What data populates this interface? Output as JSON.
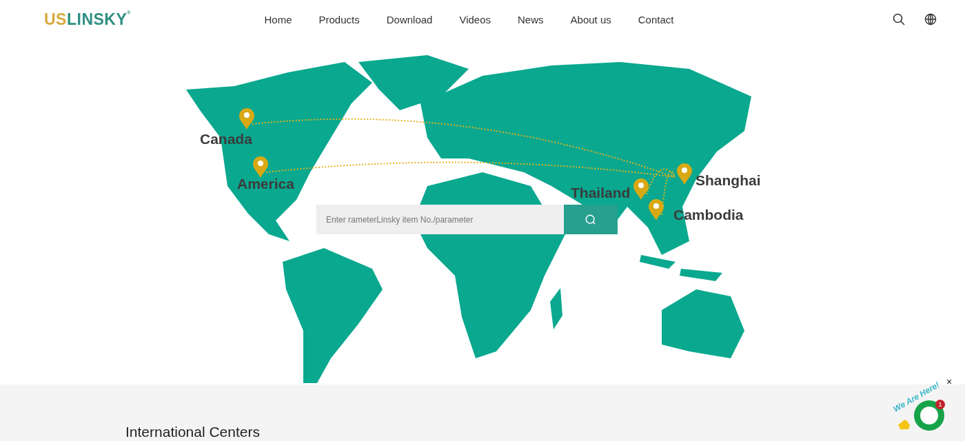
{
  "header": {
    "logo": {
      "first": "US",
      "rest": "LINSKY",
      "mark": "®"
    },
    "nav": [
      {
        "label": "Home"
      },
      {
        "label": "Products"
      },
      {
        "label": "Download"
      },
      {
        "label": "Videos"
      },
      {
        "label": "News"
      },
      {
        "label": "About us"
      },
      {
        "label": "Contact"
      }
    ]
  },
  "map": {
    "cities": [
      {
        "name": "Canada"
      },
      {
        "name": "America"
      },
      {
        "name": "Thailand"
      },
      {
        "name": "Shanghai"
      },
      {
        "name": "Cambodia"
      }
    ],
    "search": {
      "placeholder": "Enter rameterLinsky item No./parameter"
    }
  },
  "section": {
    "title": "International Centers"
  },
  "chat": {
    "slogan": "We Are Here!",
    "badge": "1",
    "close": "×"
  }
}
